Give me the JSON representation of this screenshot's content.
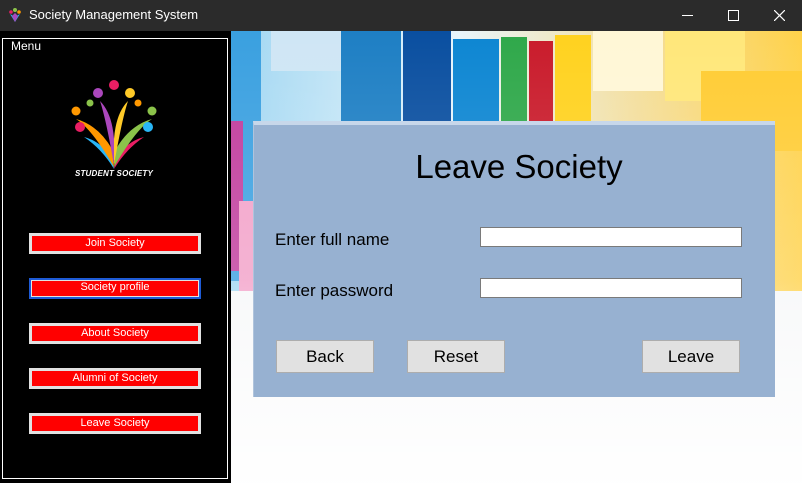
{
  "window": {
    "title": "Society Management System",
    "icon": "student-society-logo-icon"
  },
  "sidebar": {
    "legend": "Menu",
    "logo_text": "STUDENT SOCIETY",
    "items": [
      {
        "label": "Join Society"
      },
      {
        "label": "Society profile"
      },
      {
        "label": "About Society"
      },
      {
        "label": "Alumni of Society"
      },
      {
        "label": "Leave Society"
      }
    ]
  },
  "form": {
    "title": "Leave Society",
    "full_name_label": "Enter full name",
    "full_name_value": "",
    "password_label": "Enter password",
    "password_value": "",
    "back_label": "Back",
    "reset_label": "Reset",
    "leave_label": "Leave"
  },
  "colors": {
    "menu_button": "#ff0000",
    "panel": "#97b1d1",
    "sidebar": "#000000",
    "titlebar": "#2b2b2b"
  }
}
